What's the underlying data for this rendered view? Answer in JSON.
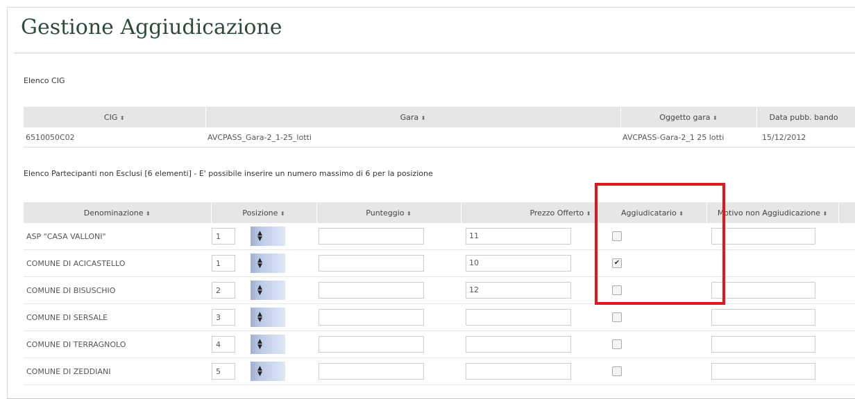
{
  "page_title": "Gestione Aggiudicazione",
  "cig_section": {
    "label": "Elenco CIG",
    "columns": [
      "CIG",
      "Gara",
      "Oggetto gara",
      "Data pubb. bando"
    ],
    "row": {
      "cig": "6510050C02",
      "gara": "AVCPASS_Gara-2_1-25_lotti",
      "oggetto": "AVCPASS-Gara-2_1 25 lotti",
      "data": "15/12/2012"
    }
  },
  "participants_section": {
    "label": "Elenco Partecipanti non Esclusi [6 elementi] - E' possibile inserire un numero massimo di 6 per la posizione",
    "columns": [
      "Denominazione",
      "Posizione",
      "Punteggio",
      "Prezzo Offerto",
      "Aggiudicatario",
      "Motivo non Aggiudicazione"
    ],
    "rows": [
      {
        "name": "ASP \"CASA VALLONI\"",
        "posizione": "1",
        "punteggio": "",
        "prezzo": "11",
        "aggiudicatario": false,
        "motivo": ""
      },
      {
        "name": "COMUNE DI ACICASTELLO",
        "posizione": "1",
        "punteggio": "",
        "prezzo": "10",
        "aggiudicatario": true,
        "motivo": ""
      },
      {
        "name": "COMUNE DI BISUSCHIO",
        "posizione": "2",
        "punteggio": "",
        "prezzo": "12",
        "aggiudicatario": false,
        "motivo": ""
      },
      {
        "name": "COMUNE DI SERSALE",
        "posizione": "3",
        "punteggio": "",
        "prezzo": "",
        "aggiudicatario": false,
        "motivo": ""
      },
      {
        "name": "COMUNE DI TERRAGNOLO",
        "posizione": "4",
        "punteggio": "",
        "prezzo": "",
        "aggiudicatario": false,
        "motivo": ""
      },
      {
        "name": "COMUNE DI ZEDDIANI",
        "posizione": "5",
        "punteggio": "",
        "prezzo": "",
        "aggiudicatario": false,
        "motivo": ""
      }
    ]
  },
  "sort_icon": "sort-arrows-icon",
  "checkmark_glyph": "✔",
  "highlight_color": "#e0181b"
}
